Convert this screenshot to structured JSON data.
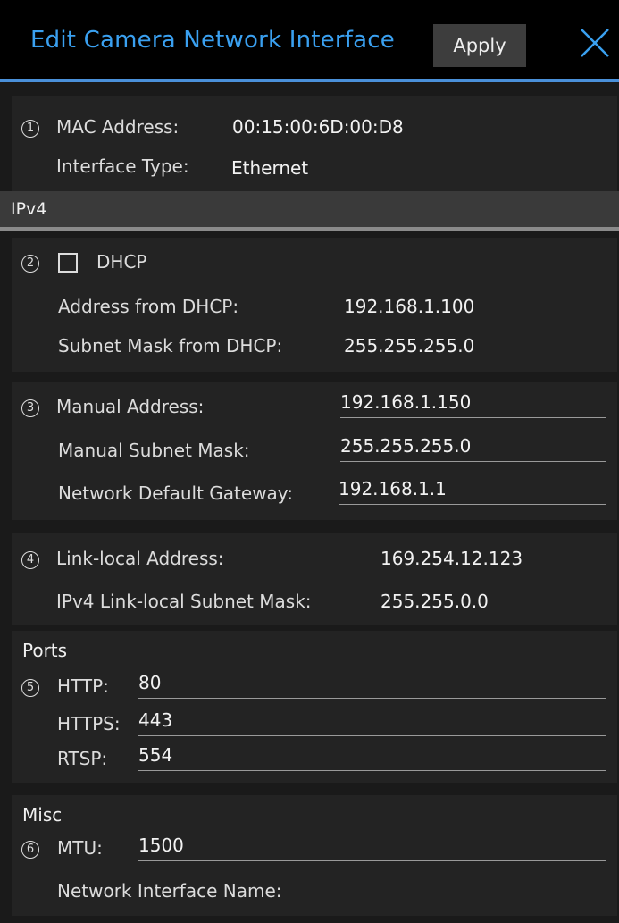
{
  "header": {
    "title": "Edit Camera Network Interface",
    "apply_label": "Apply",
    "accent_color": "#3aa0f0"
  },
  "general": {
    "marker": "1",
    "mac_label": "MAC Address:",
    "mac_value": "00:15:00:6D:00:D8",
    "type_label": "Interface Type:",
    "type_value": "Ethernet"
  },
  "ipv4_header": "IPv4",
  "dhcp": {
    "marker": "2",
    "checkbox_label": "DHCP",
    "checked": false,
    "address_label": "Address from DHCP:",
    "address_value": "192.168.1.100",
    "subnet_label": "Subnet Mask from DHCP:",
    "subnet_value": "255.255.255.0"
  },
  "manual": {
    "marker": "3",
    "address_label": "Manual Address:",
    "address_value": "192.168.1.150",
    "subnet_label": "Manual Subnet Mask:",
    "subnet_value": "255.255.255.0",
    "gateway_label": "Network Default Gateway:",
    "gateway_value": "192.168.1.1"
  },
  "link_local": {
    "marker": "4",
    "address_label": "Link-local Address:",
    "address_value": "169.254.12.123",
    "subnet_label": "IPv4 Link-local Subnet Mask:",
    "subnet_value": "255.255.0.0"
  },
  "ports": {
    "title": "Ports",
    "marker": "5",
    "http_label": "HTTP:",
    "http_value": "80",
    "https_label": "HTTPS:",
    "https_value": "443",
    "rtsp_label": "RTSP:",
    "rtsp_value": "554"
  },
  "misc": {
    "title": "Misc",
    "marker": "6",
    "mtu_label": "MTU:",
    "mtu_value": "1500",
    "name_label": "Network Interface Name:",
    "name_value": ""
  }
}
